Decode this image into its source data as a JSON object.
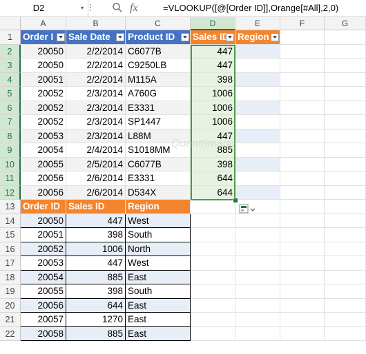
{
  "formula_bar": {
    "name_box": "D2",
    "name_box_dropdown": "▾",
    "cancel_icon": "cancel-icon",
    "fx_label": "fx",
    "formula": "=VLOOKUP([@[Order ID]],Orange[#All],2,0)"
  },
  "columns": [
    "A",
    "B",
    "C",
    "D",
    "E",
    "F",
    "G"
  ],
  "rows": [
    "1",
    "2",
    "3",
    "4",
    "5",
    "6",
    "7",
    "8",
    "9",
    "10",
    "11",
    "12",
    "13",
    "14",
    "15",
    "16",
    "17",
    "18",
    "19",
    "20",
    "21",
    "22"
  ],
  "selected_column": "D",
  "table_blue": {
    "headers": [
      "Order I",
      "Sale Date",
      "Product ID",
      "Sales ID",
      "Region"
    ],
    "rows": [
      {
        "order": "20050",
        "date": "2/2/2014",
        "product": "C6077B",
        "sales": "447",
        "region": ""
      },
      {
        "order": "20050",
        "date": "2/2/2014",
        "product": "C9250LB",
        "sales": "447",
        "region": ""
      },
      {
        "order": "20051",
        "date": "2/2/2014",
        "product": "M115A",
        "sales": "398",
        "region": ""
      },
      {
        "order": "20052",
        "date": "2/3/2014",
        "product": "A760G",
        "sales": "1006",
        "region": ""
      },
      {
        "order": "20052",
        "date": "2/3/2014",
        "product": "E3331",
        "sales": "1006",
        "region": ""
      },
      {
        "order": "20052",
        "date": "2/3/2014",
        "product": "SP1447",
        "sales": "1006",
        "region": ""
      },
      {
        "order": "20053",
        "date": "2/3/2014",
        "product": "L88M",
        "sales": "447",
        "region": ""
      },
      {
        "order": "20054",
        "date": "2/4/2014",
        "product": "S1018MM",
        "sales": "885",
        "region": ""
      },
      {
        "order": "20055",
        "date": "2/5/2014",
        "product": "C6077B",
        "sales": "398",
        "region": ""
      },
      {
        "order": "20056",
        "date": "2/6/2014",
        "product": "E3331",
        "sales": "644",
        "region": ""
      },
      {
        "order": "20056",
        "date": "2/6/2014",
        "product": "D534X",
        "sales": "644",
        "region": ""
      }
    ]
  },
  "table_orange": {
    "headers": [
      "Order ID",
      "Sales ID",
      "Region"
    ],
    "rows": [
      {
        "order": "20050",
        "sales": "447",
        "region": "West"
      },
      {
        "order": "20051",
        "sales": "398",
        "region": "South"
      },
      {
        "order": "20052",
        "sales": "1006",
        "region": "North"
      },
      {
        "order": "20053",
        "sales": "447",
        "region": "West"
      },
      {
        "order": "20054",
        "sales": "885",
        "region": "East"
      },
      {
        "order": "20055",
        "sales": "398",
        "region": "South"
      },
      {
        "order": "20056",
        "sales": "644",
        "region": "East"
      },
      {
        "order": "20057",
        "sales": "1270",
        "region": "East"
      },
      {
        "order": "20058",
        "sales": "885",
        "region": "East"
      }
    ]
  },
  "quick_analysis_icon": "quick-analysis-icon",
  "watermark": "Quantrimang",
  "colors": {
    "blue_header": "#4472c4",
    "orange_header": "#f4852f",
    "selection": "#217346"
  }
}
